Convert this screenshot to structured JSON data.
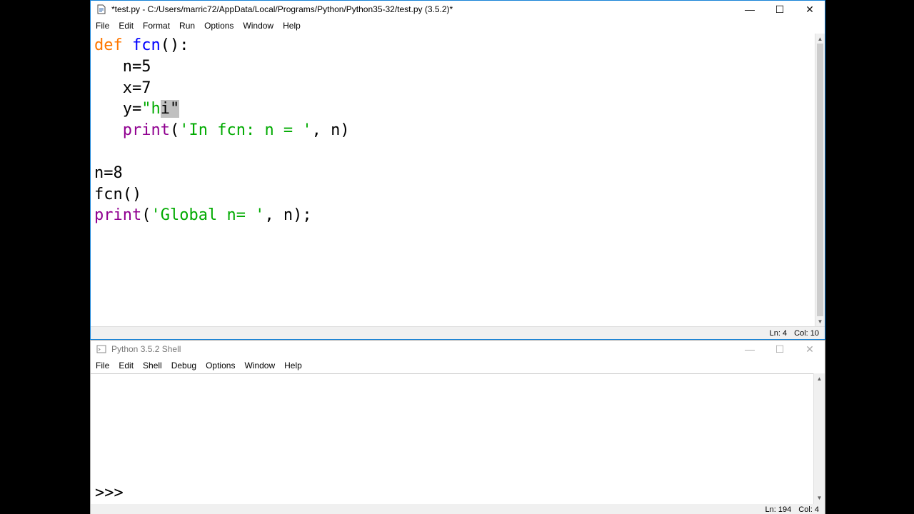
{
  "editor": {
    "title": "*test.py - C:/Users/marric72/AppData/Local/Programs/Python/Python35-32/test.py (3.5.2)*",
    "menu": [
      "File",
      "Edit",
      "Format",
      "Run",
      "Options",
      "Window",
      "Help"
    ],
    "code": {
      "def": "def",
      "fcn_name": "fcn",
      "def_rest": "():",
      "line2": "n=5",
      "line3": "x=7",
      "y_prefix": "y=",
      "y_q1": "\"",
      "y_h": "h",
      "y_i": "i",
      "y_q2": "\"",
      "print1_kw": "print",
      "print1_open": "(",
      "print1_str": "'In fcn: n = '",
      "print1_rest": ", n)",
      "line7": "n=8",
      "line8": "fcn()",
      "print2_kw": "print",
      "print2_open": "(",
      "print2_str": "'Global n= '",
      "print2_rest": ", n);"
    },
    "status": {
      "ln": "Ln: 4",
      "col": "Col: 10"
    }
  },
  "shell": {
    "title": "Python 3.5.2 Shell",
    "menu": [
      "File",
      "Edit",
      "Shell",
      "Debug",
      "Options",
      "Window",
      "Help"
    ],
    "prompt": ">>>",
    "status": {
      "ln": "Ln: 194",
      "col": "Col: 4"
    }
  },
  "window_controls": {
    "minimize": "—",
    "maximize": "☐",
    "close": "✕"
  }
}
